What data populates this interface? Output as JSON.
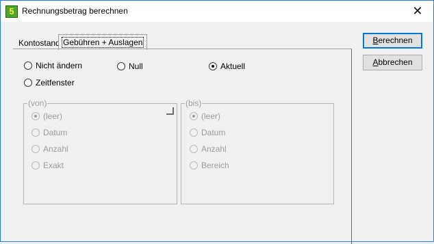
{
  "window": {
    "title": "Rechnungsbetrag berechnen",
    "app_icon_text": "5"
  },
  "tabs": [
    {
      "label": "Kontostand",
      "active": false
    },
    {
      "label": "Gebühren + Auslagen",
      "active": true
    }
  ],
  "buttons": {
    "calculate": {
      "label": "Berechnen",
      "mnemonic": "B",
      "rest": "erechnen"
    },
    "cancel": {
      "label": "Abbrechen",
      "mnemonic": "A",
      "rest": "bbrechen"
    }
  },
  "mode_options": [
    {
      "label": "Nicht ändern",
      "checked": false
    },
    {
      "label": "Null",
      "checked": false
    },
    {
      "label": "Aktuell",
      "checked": true
    },
    {
      "label": "Zeitfenster",
      "checked": false
    }
  ],
  "group_von": {
    "label": "(von)",
    "options": [
      {
        "label": "(leer)",
        "checked": true
      },
      {
        "label": "Datum",
        "checked": false
      },
      {
        "label": "Anzahl",
        "checked": false
      },
      {
        "label": "Exakt",
        "checked": false
      }
    ]
  },
  "group_bis": {
    "label": "(bis)",
    "options": [
      {
        "label": "(leer)",
        "checked": true
      },
      {
        "label": "Datum",
        "checked": false
      },
      {
        "label": "Anzahl",
        "checked": false
      },
      {
        "label": "Bereich",
        "checked": false
      }
    ]
  }
}
